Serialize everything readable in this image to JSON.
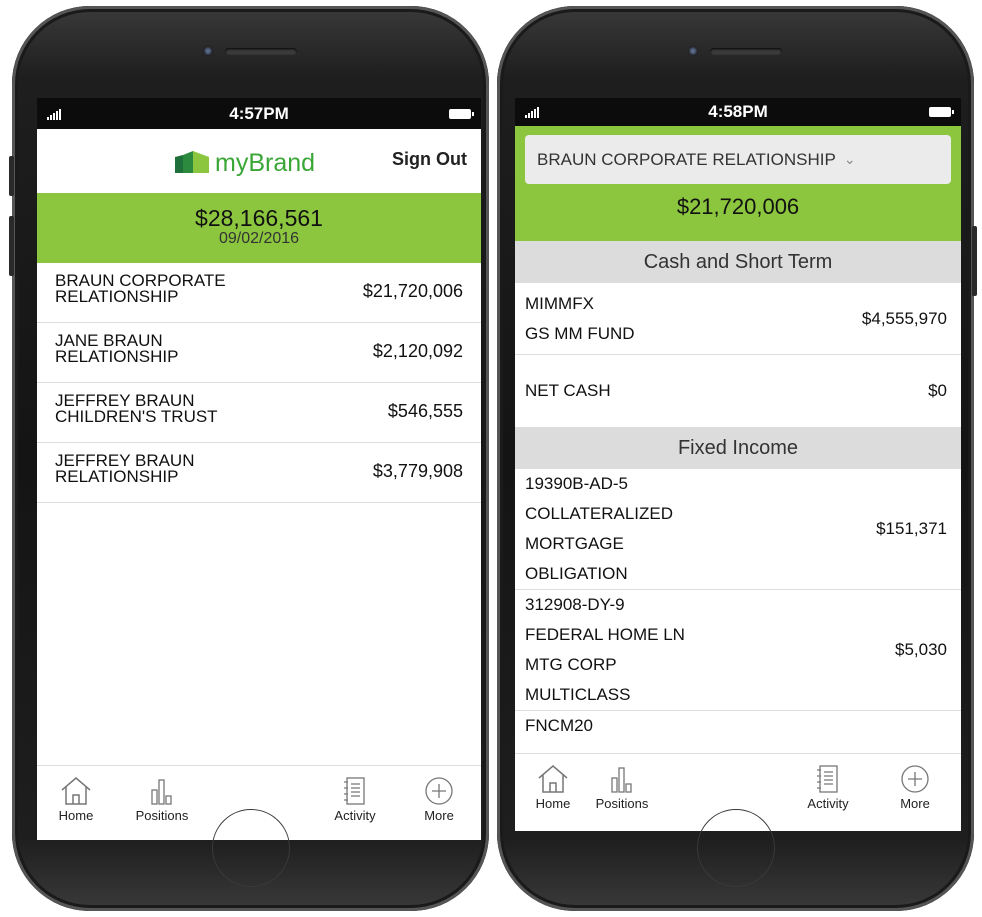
{
  "left": {
    "status": {
      "time": "4:57PM"
    },
    "header": {
      "brand": "myBrand",
      "sign_out": "Sign Out"
    },
    "summary": {
      "total": "$28,166,561",
      "date": "09/02/2016"
    },
    "relationships": [
      {
        "name": "BRAUN CORPORATE RELATIONSHIP",
        "amount": "$21,720,006"
      },
      {
        "name": "JANE BRAUN RELATIONSHIP",
        "amount": "$2,120,092"
      },
      {
        "name": "JEFFREY BRAUN CHILDREN'S TRUST",
        "amount": "$546,555"
      },
      {
        "name": "JEFFREY BRAUN RELATIONSHIP",
        "amount": "$3,779,908"
      }
    ],
    "tabs": {
      "home": "Home",
      "positions": "Positions",
      "activity": "Activity",
      "more": "More"
    }
  },
  "right": {
    "status": {
      "time": "4:58PM"
    },
    "selector": {
      "value": "BRAUN CORPORATE RELATIONSHIP"
    },
    "summary": {
      "total": "$21,720,006"
    },
    "sections": [
      {
        "title": "Cash and Short Term",
        "rows": [
          {
            "lines": [
              "MIMMFX",
              "GS MM FUND"
            ],
            "amount": "$4,555,970"
          },
          {
            "lines": [
              "NET CASH"
            ],
            "amount": "$0"
          }
        ]
      },
      {
        "title": "Fixed Income",
        "rows": [
          {
            "lines": [
              "19390B-AD-5",
              "COLLATERALIZED",
              "MORTGAGE",
              "OBLIGATION"
            ],
            "amount": "$151,371"
          },
          {
            "lines": [
              "312908-DY-9",
              "FEDERAL HOME LN",
              "MTG CORP",
              "MULTICLASS"
            ],
            "amount": "$5,030"
          },
          {
            "lines": [
              "FNCM20"
            ],
            "amount": ""
          }
        ]
      }
    ],
    "tabs": {
      "home": "Home",
      "positions": "Positions",
      "activity": "Activity",
      "more": "More"
    }
  },
  "colors": {
    "accent_green": "#8cc63f",
    "brand_green": "#3aa636"
  }
}
